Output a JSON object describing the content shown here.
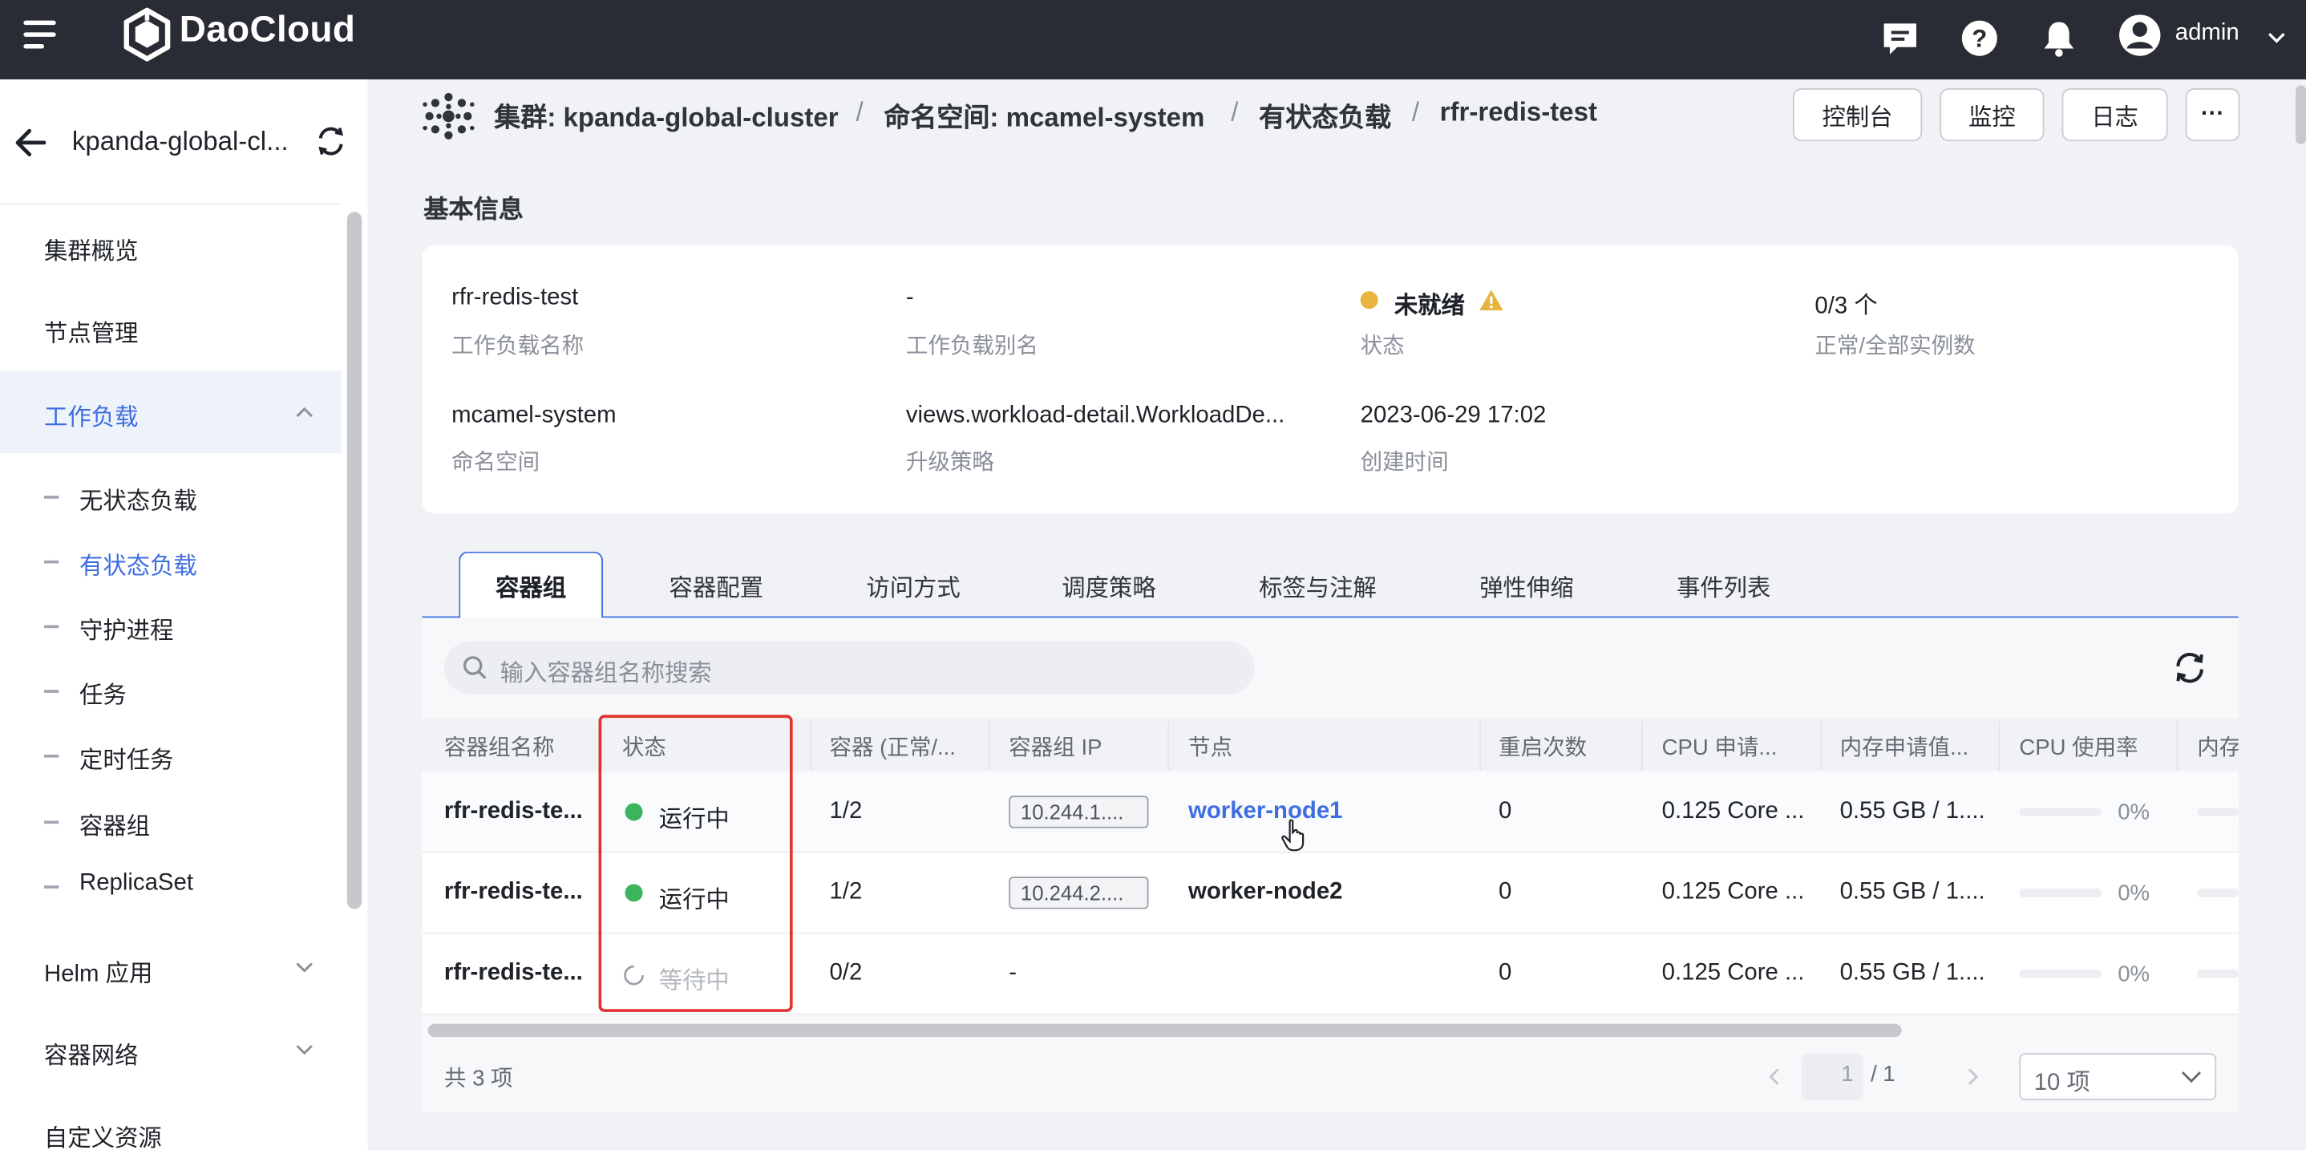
{
  "app": {
    "brand": "DaoCloud",
    "user": "admin"
  },
  "sidebar": {
    "cluster": "kpanda-global-cl...",
    "items": [
      {
        "label": "集群概览"
      },
      {
        "label": "节点管理"
      },
      {
        "label": "工作负载"
      },
      {
        "label": "Helm 应用"
      },
      {
        "label": "容器网络"
      },
      {
        "label": "自定义资源"
      }
    ],
    "sub_items": [
      {
        "label": "无状态负载"
      },
      {
        "label": "有状态负载"
      },
      {
        "label": "守护进程"
      },
      {
        "label": "任务"
      },
      {
        "label": "定时任务"
      },
      {
        "label": "容器组"
      },
      {
        "label": "ReplicaSet"
      }
    ]
  },
  "breadcrumb": {
    "cluster": "集群:  kpanda-global-cluster",
    "namespace": "命名空间:  mcamel-system",
    "kind": "有状态负载",
    "name": "rfr-redis-test",
    "sep": "/"
  },
  "actions": {
    "console": "控制台",
    "monitor": "监控",
    "logs": "日志",
    "more": "···"
  },
  "basic_info": {
    "title": "基本信息",
    "name_value": "rfr-redis-test",
    "name_label": "工作负载名称",
    "alias_value": "-",
    "alias_label": "工作负载别名",
    "status_value": "未就绪",
    "status_label": "状态",
    "replicas_value": "0/3 个",
    "replicas_label": "正常/全部实例数",
    "ns_value": "mcamel-system",
    "ns_label": "命名空间",
    "strategy_value": "views.workload-detail.WorkloadDe...",
    "strategy_label": "升级策略",
    "created_value": "2023-06-29 17:02",
    "created_label": "创建时间"
  },
  "tabs": [
    "容器组",
    "容器配置",
    "访问方式",
    "调度策略",
    "标签与注解",
    "弹性伸缩",
    "事件列表"
  ],
  "search": {
    "placeholder": "输入容器组名称搜索"
  },
  "table": {
    "headers": [
      "容器组名称",
      "状态",
      "容器 (正常/...",
      "容器组 IP",
      "节点",
      "重启次数",
      "CPU 申请...",
      "内存申请值...",
      "CPU 使用率",
      "内存"
    ],
    "rows": [
      {
        "name": "rfr-redis-te...",
        "status": "运行中",
        "containers": "1/2",
        "ip": "10.244.1....",
        "node": "worker-node1",
        "restarts": "0",
        "cpu_req": "0.125 Core ...",
        "mem_req": "0.55 GB / 1....",
        "cpu_usage": "0%"
      },
      {
        "name": "rfr-redis-te...",
        "status": "运行中",
        "containers": "1/2",
        "ip": "10.244.2....",
        "node": "worker-node2",
        "restarts": "0",
        "cpu_req": "0.125 Core ...",
        "mem_req": "0.55 GB / 1....",
        "cpu_usage": "0%"
      },
      {
        "name": "rfr-redis-te...",
        "status": "等待中",
        "containers": "0/2",
        "ip": "-",
        "node": "",
        "restarts": "0",
        "cpu_req": "0.125 Core ...",
        "mem_req": "0.55 GB / 1....",
        "cpu_usage": "0%"
      }
    ]
  },
  "pagination": {
    "total": "共 3 项",
    "page": "1",
    "pages": "/ 1",
    "page_size": "10 项"
  },
  "colors": {
    "accent": "#3d6ee0",
    "running": "#3bb45c",
    "warning": "#e8b33e",
    "highlight": "#e0362e"
  }
}
